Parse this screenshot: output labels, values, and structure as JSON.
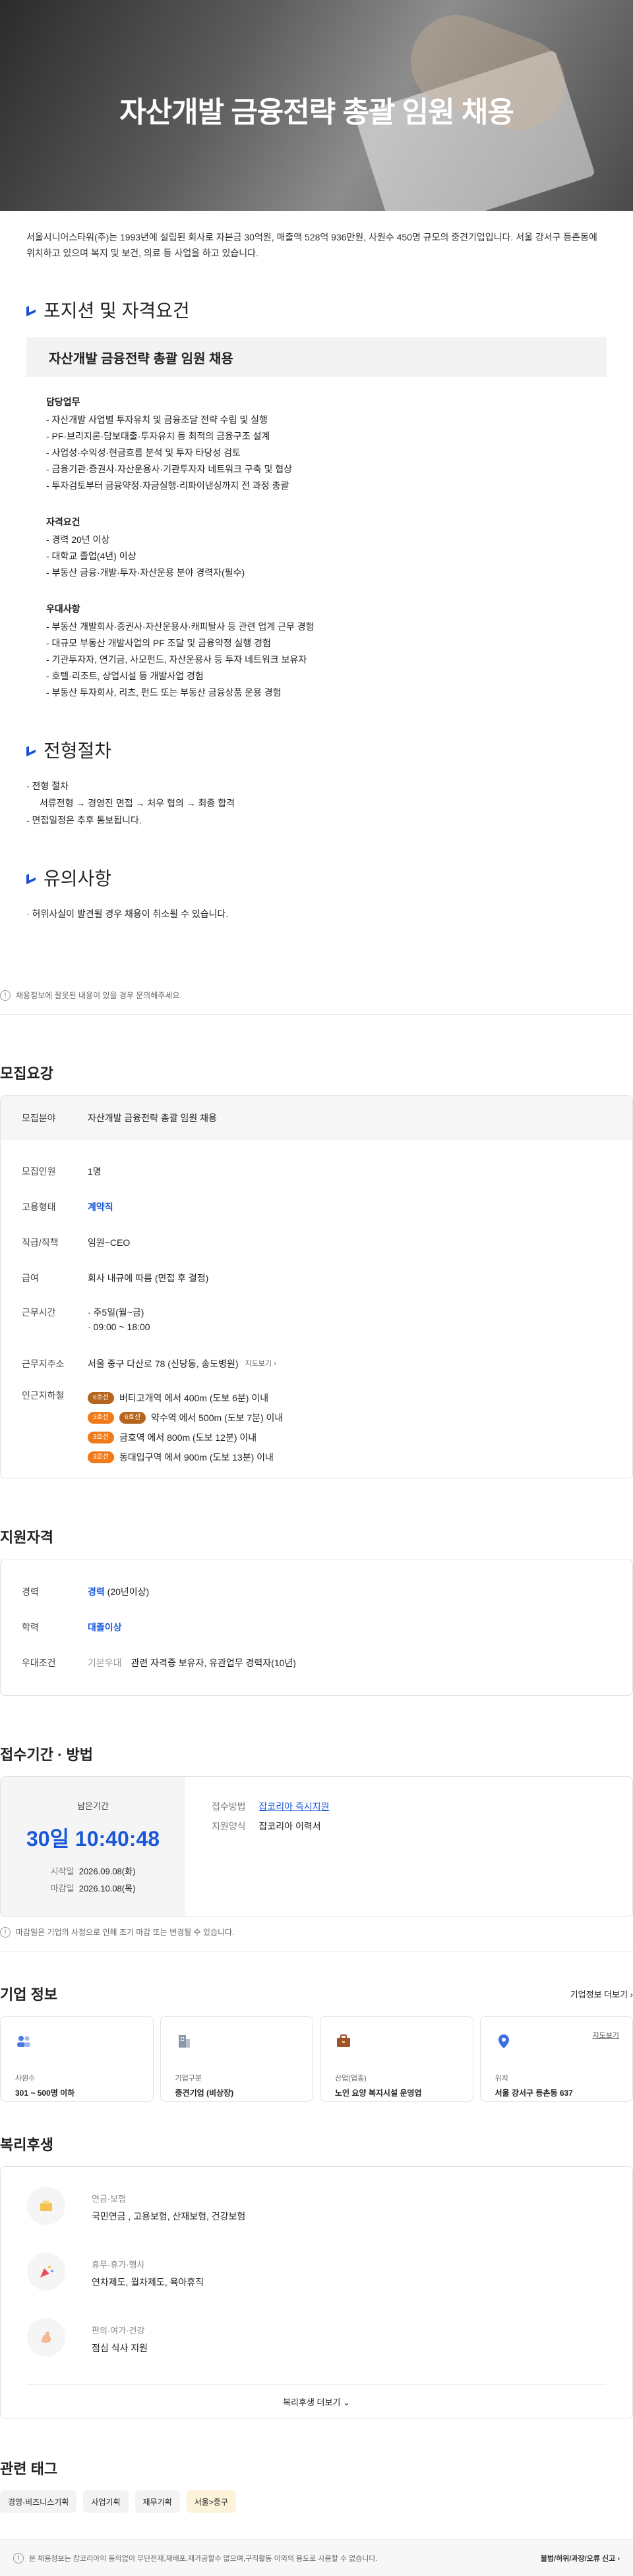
{
  "hero": {
    "title": "자산개발 금융전략 총괄 임원 채용"
  },
  "intro": "서울시니어스타워(주)는 1993년에 설립된 회사로 자본금 30억원, 매출액 528억 936만원, 사원수 450명 규모의 중견기업입니다. 서울 강서구 등촌동에 위치하고 있으며 복지 및 보건, 의료 등 사업을 하고 있습니다.",
  "position": {
    "title": "포지션 및 자격요건",
    "box": "자산개발 금융전략 총괄 임원 채용",
    "duties_title": "담당업무",
    "duties": [
      "- 자산개발 사업별 투자유치 및 금융조달 전략 수립 및 실행",
      "- PF·브리지론·담보대출·투자유치 등 최적의 금융구조 설계",
      "- 사업성·수익성·현금흐름 분석 및 투자 타당성 검토",
      "- 금융기관·증권사·자산운용사·기관투자자 네트워크 구축 및 협상",
      "- 투자검토부터 금융약정·자금실행·리파이낸싱까지 전 과정 총괄"
    ],
    "qual_title": "자격요건",
    "quals": [
      "- 경력 20년 이상",
      "- 대학교 졸업(4년) 이상",
      "- 부동산 금융·개발·투자·자산운용 분야 경력자(필수)"
    ],
    "pref_title": "우대사항",
    "prefs": [
      "- 부동산 개발회사·증권사·자산운용사·캐피탈사 등 관련 업계 근무 경험",
      "- 대규모 부동산 개발사업의 PF 조달 및 금융약정 실행 경험",
      "- 기관투자자, 연기금, 사모펀드, 자산운용사 등 투자 네트워크 보유자",
      "- 호텔·리조트, 상업시설 등 개발사업 경험",
      "- 부동산 투자회사, 리츠, 펀드 또는 부동산 금융상품 운용 경험"
    ]
  },
  "process": {
    "title": "전형절차",
    "line1": "- 전형 절차",
    "line2": "서류전형 → 경영진 면접 → 처우 협의 → 최종 합격",
    "line3": "- 면접일정은 추후 통보됩니다."
  },
  "caution": {
    "title": "유의사항",
    "line1": "· 허위사실이 발견될 경우 채용이 취소될 수 있습니다.",
    "note": "채용정보에 잘못된 내용이 있을 경우 문의해주세요."
  },
  "recruit": {
    "title": "모집요강",
    "field_k": "모집분야",
    "field_v": "자산개발 금융전략 총괄 임원 채용",
    "count_k": "모집인원",
    "count_v": "1명",
    "type_k": "고용형태",
    "type_v": "계약직",
    "rank_k": "직급/직책",
    "rank_v": "임원~CEO",
    "pay_k": "급여",
    "pay_v": "회사 내규에 따름 (면접 후 결정)",
    "hours_k": "근무시간",
    "hours_v1": "· 주5일(월~금)",
    "hours_v2": "· 09:00 ~ 18:00",
    "addr_k": "근무지주소",
    "addr_v": "서울 중구 다산로 78 (신당동, 송도병원)",
    "addr_link": "지도보기 ›",
    "subway_k": "인근지하철",
    "subway": [
      {
        "lines": [
          {
            "name": "6호선",
            "color": "#b5651d"
          }
        ],
        "text": "버티고개역 에서 400m (도보 6분) 이내"
      },
      {
        "lines": [
          {
            "name": "3호선",
            "color": "#f07a1a"
          },
          {
            "name": "6호선",
            "color": "#b5651d"
          }
        ],
        "text": "약수역 에서 500m (도보 7분) 이내"
      },
      {
        "lines": [
          {
            "name": "3호선",
            "color": "#f07a1a"
          }
        ],
        "text": "금호역 에서 800m (도보 12분) 이내"
      },
      {
        "lines": [
          {
            "name": "3호선",
            "color": "#f07a1a"
          }
        ],
        "text": "동대입구역 에서 900m (도보 13분) 이내"
      }
    ]
  },
  "qualification": {
    "title": "지원자격",
    "career_k": "경력",
    "career_v": "경력",
    "career_s": "(20년이상)",
    "edu_k": "학력",
    "edu_v": "대졸이상",
    "pref_k": "우대조건",
    "pref_l": "기본우대",
    "pref_v": "관련 자격증 보유자, 유관업무 경력자(10년)"
  },
  "apply": {
    "title": "접수기간 · 방법",
    "remain_label": "남은기간",
    "remain": "30일 10:40:48",
    "start_k": "시작일",
    "start_v": "2026.09.08(화)",
    "end_k": "마감일",
    "end_v": "2026.10.08(목)",
    "method_k": "접수방법",
    "method_v": "잡코리아 즉시지원",
    "form_k": "지원양식",
    "form_v": "잡코리아 이력서",
    "note": "마감일은 기업의 사정으로 인해 조기 마감 또는 변경될 수 있습니다."
  },
  "company": {
    "title": "기업 정보",
    "more": "기업정보 더보기 ›",
    "cards": [
      {
        "icon": "people-icon",
        "label": "사원수",
        "value": "301 ~ 500명 이하"
      },
      {
        "icon": "building-icon",
        "label": "기업구분",
        "value": "중견기업 (비상장)"
      },
      {
        "icon": "briefcase-icon",
        "label": "산업(업종)",
        "value": "노인 요양 복지시설 운영업"
      },
      {
        "icon": "location-icon",
        "label": "위치",
        "value": "서울 강서구 등촌동 637",
        "link": "지도보기"
      }
    ]
  },
  "welfare": {
    "title": "복리후생",
    "items": [
      {
        "icon": "pension-icon",
        "t1": "연금·보험",
        "t2": "국민연금 , 고용보험, 산재보험, 건강보험"
      },
      {
        "icon": "party-icon",
        "t1": "휴무·휴가·행사",
        "t2": "연차제도, 월차제도, 육아휴직"
      },
      {
        "icon": "muscle-icon",
        "t1": "편의·여가·건강",
        "t2": "점심 식사 지원"
      }
    ],
    "more": "복리후생 더보기 ⌄"
  },
  "tags": {
    "title": "관련 태그",
    "items": [
      "경영·비즈니스기획",
      "사업기획",
      "재무기획",
      "서울>중구"
    ]
  },
  "footer": {
    "text": "본 채용정보는 잡코리아의 동의없이 무단전재,재배포,재가공할수 없으며,구직활동 이외의 용도로 사용할 수 없습니다.",
    "link": "불법/허위/과장/오류 신고 ›"
  }
}
